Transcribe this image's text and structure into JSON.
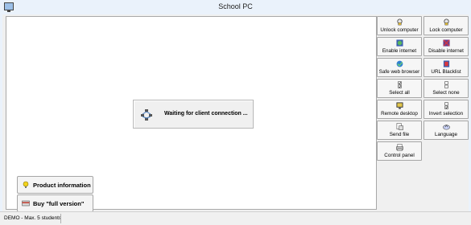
{
  "window": {
    "title": "School PC"
  },
  "canvas": {
    "waiting_text": "Waiting for client connection ..."
  },
  "buttons": {
    "product_info": "Product information",
    "buy": "Buy \"full version\""
  },
  "sidebar": {
    "tiles": [
      {
        "label": "Unlock computer",
        "icon": "unlock-icon"
      },
      {
        "label": "Lock computer",
        "icon": "lock-icon"
      },
      {
        "label": "Enable internet",
        "icon": "internet-icon"
      },
      {
        "label": "Disable internet",
        "icon": "no-internet-icon"
      },
      {
        "label": "Safe web browser",
        "icon": "safe-browser-icon"
      },
      {
        "label": "URL Blacklist",
        "icon": "blacklist-icon"
      },
      {
        "label": "Select all",
        "icon": "select-all-icon"
      },
      {
        "label": "Select none",
        "icon": "select-none-icon"
      },
      {
        "label": "Remote desktop",
        "icon": "remote-desktop-icon"
      },
      {
        "label": "Invert selection",
        "icon": "invert-selection-icon"
      },
      {
        "label": "Send file",
        "icon": "send-file-icon"
      },
      {
        "label": "Language",
        "icon": "language-icon"
      },
      {
        "label": "Control panel",
        "icon": "control-panel-icon"
      }
    ]
  },
  "status": {
    "text": "DEMO - Max. 5 students"
  },
  "colors": {
    "title_bg": "#eaf2fb",
    "panel_bg": "#f0f0f0",
    "canvas_bg": "#ffffff",
    "border": "#a6a6a6"
  }
}
